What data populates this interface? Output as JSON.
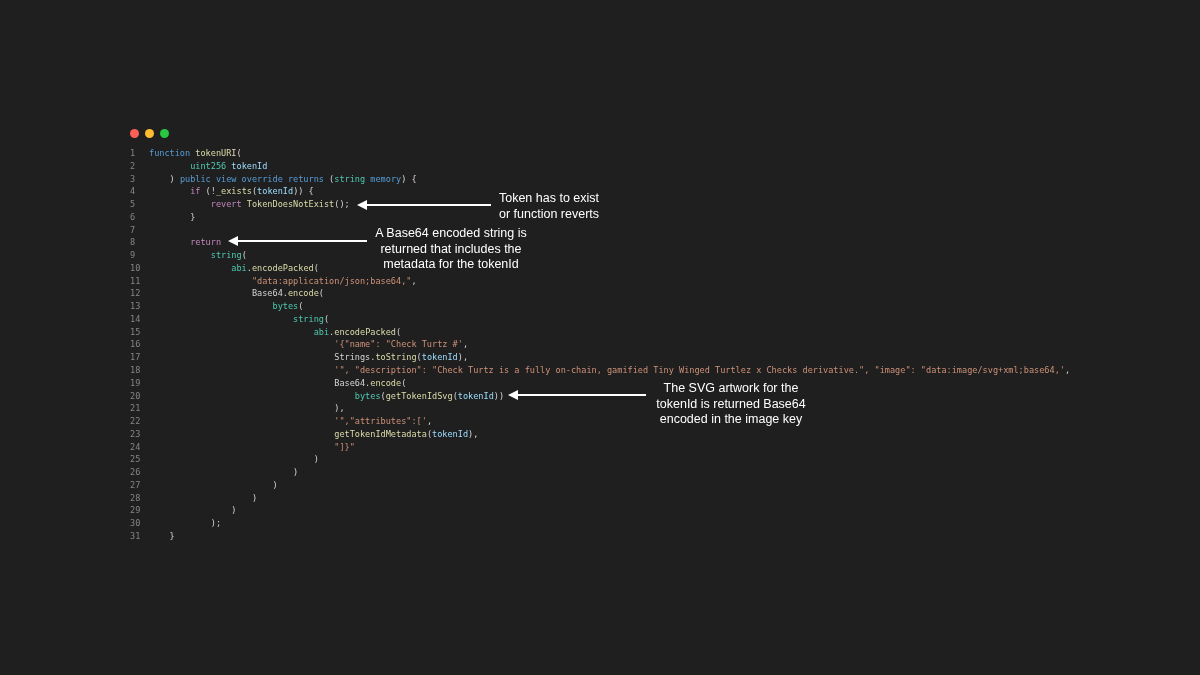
{
  "window_controls": [
    {
      "color": "#ff5f57"
    },
    {
      "color": "#febc2e"
    },
    {
      "color": "#28c840"
    }
  ],
  "code_lines": [
    {
      "number": "1",
      "tokens": [
        {
          "kind": "keyword",
          "text": "function "
        },
        {
          "kind": "function",
          "text": "tokenURI"
        },
        {
          "kind": "plain",
          "text": "("
        }
      ]
    },
    {
      "number": "2",
      "tokens": [
        {
          "kind": "type",
          "text": "        uint256 "
        },
        {
          "kind": "variable",
          "text": "tokenId"
        }
      ]
    },
    {
      "number": "3",
      "tokens": [
        {
          "kind": "plain",
          "text": "    ) "
        },
        {
          "kind": "keyword",
          "text": "public view override returns"
        },
        {
          "kind": "plain",
          "text": " ("
        },
        {
          "kind": "type",
          "text": "string "
        },
        {
          "kind": "keyword",
          "text": "memory"
        },
        {
          "kind": "plain",
          "text": ") {"
        }
      ]
    },
    {
      "number": "4",
      "tokens": [
        {
          "kind": "control",
          "text": "        if"
        },
        {
          "kind": "plain",
          "text": " (!"
        },
        {
          "kind": "function",
          "text": "_exists"
        },
        {
          "kind": "plain",
          "text": "("
        },
        {
          "kind": "variable",
          "text": "tokenId"
        },
        {
          "kind": "plain",
          "text": ")) {"
        }
      ]
    },
    {
      "number": "5",
      "tokens": [
        {
          "kind": "control",
          "text": "            revert "
        },
        {
          "kind": "function",
          "text": "TokenDoesNotExist"
        },
        {
          "kind": "plain",
          "text": "();"
        }
      ]
    },
    {
      "number": "6",
      "tokens": [
        {
          "kind": "plain",
          "text": "        }"
        }
      ]
    },
    {
      "number": "7"
    },
    {
      "number": "8",
      "tokens": [
        {
          "kind": "control",
          "text": "        return"
        }
      ]
    },
    {
      "number": "9",
      "tokens": [
        {
          "kind": "type",
          "text": "            string"
        },
        {
          "kind": "plain",
          "text": "("
        }
      ]
    },
    {
      "number": "10",
      "tokens": [
        {
          "kind": "type",
          "text": "                abi"
        },
        {
          "kind": "plain",
          "text": "."
        },
        {
          "kind": "function",
          "text": "encodePacked"
        },
        {
          "kind": "plain",
          "text": "("
        }
      ]
    },
    {
      "number": "11",
      "tokens": [
        {
          "kind": "string",
          "text": "                    \"data:application/json;base64,\""
        },
        {
          "kind": "plain",
          "text": ","
        }
      ]
    },
    {
      "number": "12",
      "tokens": [
        {
          "kind": "plain",
          "text": "                    Base64."
        },
        {
          "kind": "function",
          "text": "encode"
        },
        {
          "kind": "plain",
          "text": "("
        }
      ]
    },
    {
      "number": "13",
      "tokens": [
        {
          "kind": "type",
          "text": "                        bytes"
        },
        {
          "kind": "plain",
          "text": "("
        }
      ]
    },
    {
      "number": "14",
      "tokens": [
        {
          "kind": "type",
          "text": "                            string"
        },
        {
          "kind": "plain",
          "text": "("
        }
      ]
    },
    {
      "number": "15",
      "tokens": [
        {
          "kind": "type",
          "text": "                                abi"
        },
        {
          "kind": "plain",
          "text": "."
        },
        {
          "kind": "function",
          "text": "encodePacked"
        },
        {
          "kind": "plain",
          "text": "("
        }
      ]
    },
    {
      "number": "16",
      "tokens": [
        {
          "kind": "string",
          "text": "                                    '{\"name\": \"Check Turtz #'"
        },
        {
          "kind": "plain",
          "text": ","
        }
      ]
    },
    {
      "number": "17",
      "tokens": [
        {
          "kind": "plain",
          "text": "                                    Strings."
        },
        {
          "kind": "function",
          "text": "toString"
        },
        {
          "kind": "plain",
          "text": "("
        },
        {
          "kind": "variable",
          "text": "tokenId"
        },
        {
          "kind": "plain",
          "text": "),"
        }
      ]
    },
    {
      "number": "18",
      "tokens": [
        {
          "kind": "string",
          "text": "                                    '\", \"description\": \"Check Turtz is a fully on-chain, gamified Tiny Winged Turtlez x Checks derivative.\", \"image\": \"data:image/svg+xml;base64,'"
        },
        {
          "kind": "plain",
          "text": ","
        }
      ]
    },
    {
      "number": "19",
      "tokens": [
        {
          "kind": "plain",
          "text": "                                    Base64."
        },
        {
          "kind": "function",
          "text": "encode"
        },
        {
          "kind": "plain",
          "text": "("
        }
      ]
    },
    {
      "number": "20",
      "tokens": [
        {
          "kind": "type",
          "text": "                                        bytes"
        },
        {
          "kind": "plain",
          "text": "("
        },
        {
          "kind": "function",
          "text": "getTokenIdSvg"
        },
        {
          "kind": "plain",
          "text": "("
        },
        {
          "kind": "variable",
          "text": "tokenId"
        },
        {
          "kind": "plain",
          "text": "))"
        }
      ]
    },
    {
      "number": "21",
      "tokens": [
        {
          "kind": "plain",
          "text": "                                    ),"
        }
      ]
    },
    {
      "number": "22",
      "tokens": [
        {
          "kind": "string",
          "text": "                                    '\",\"attributes\":['"
        },
        {
          "kind": "plain",
          "text": ","
        }
      ]
    },
    {
      "number": "23",
      "tokens": [
        {
          "kind": "function",
          "text": "                                    getTokenIdMetadata"
        },
        {
          "kind": "plain",
          "text": "("
        },
        {
          "kind": "variable",
          "text": "tokenId"
        },
        {
          "kind": "plain",
          "text": "),"
        }
      ]
    },
    {
      "number": "24",
      "tokens": [
        {
          "kind": "string",
          "text": "                                    \"]}\""
        }
      ]
    },
    {
      "number": "25",
      "tokens": [
        {
          "kind": "plain",
          "text": "                                )"
        }
      ]
    },
    {
      "number": "26",
      "tokens": [
        {
          "kind": "plain",
          "text": "                            )"
        }
      ]
    },
    {
      "number": "27",
      "tokens": [
        {
          "kind": "plain",
          "text": "                        )"
        }
      ]
    },
    {
      "number": "28",
      "tokens": [
        {
          "kind": "plain",
          "text": "                    )"
        }
      ]
    },
    {
      "number": "29",
      "tokens": [
        {
          "kind": "plain",
          "text": "                )"
        }
      ]
    },
    {
      "number": "30",
      "tokens": [
        {
          "kind": "plain",
          "text": "            );"
        }
      ]
    },
    {
      "number": "31",
      "tokens": [
        {
          "kind": "plain",
          "text": "    }"
        }
      ]
    }
  ],
  "annotations": [
    {
      "text": "Token has to exist\nor function reverts"
    },
    {
      "text": "A Base64 encoded string is\nreturned that includes the\nmetadata for the tokenId"
    },
    {
      "text": "The SVG artwork for the\ntokenId is returned Base64\nencoded in the image key"
    }
  ]
}
